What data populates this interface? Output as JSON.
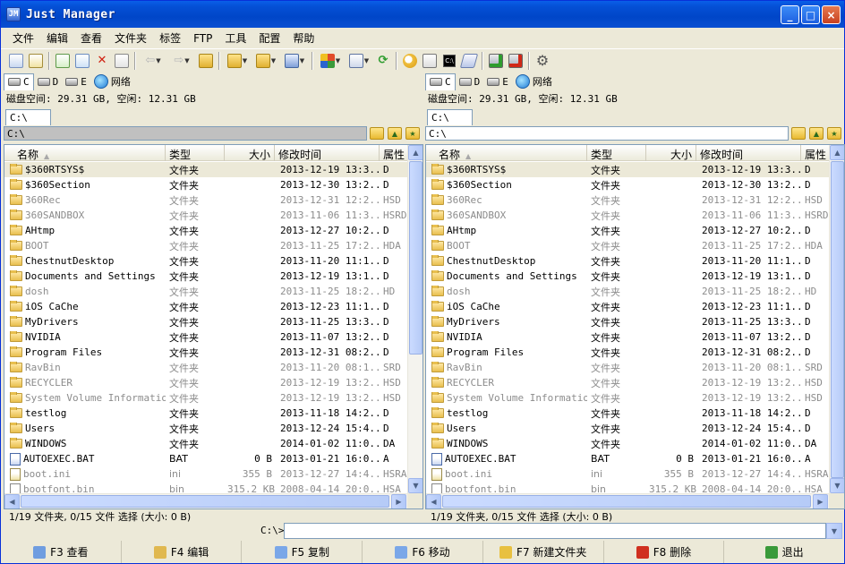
{
  "window": {
    "title": "Just Manager",
    "icon_text": "JM"
  },
  "title_buttons": {
    "minimize": "_",
    "maximize": "□",
    "close": "×"
  },
  "menu": [
    "文件",
    "编辑",
    "查看",
    "文件夹",
    "标签",
    "FTP",
    "工具",
    "配置",
    "帮助"
  ],
  "toolbar": {
    "icons": [
      "view-icon",
      "edit-icon",
      "new-file-icon",
      "copy-icon",
      "delete-icon",
      "properties-icon",
      "back-icon",
      "forward-icon",
      "up-folder-icon",
      "folder-dropdown-icon",
      "folder-sync-icon",
      "open-with-icon",
      "layout-icon",
      "sort-icon",
      "refresh-icon",
      "search-icon",
      "copy-path-icon",
      "console-icon",
      "tag-icon",
      "connect-icon",
      "disconnect-icon",
      "settings-icon"
    ],
    "console_label": "C:\\"
  },
  "panels": {
    "left": {
      "drives": [
        {
          "label": "C",
          "active": true
        },
        {
          "label": "D",
          "active": false
        },
        {
          "label": "E",
          "active": false
        }
      ],
      "network_label": "网络",
      "disk_info": "磁盘空间: 29.31 GB, 空闲: 12.31 GB",
      "tab": "C:\\",
      "path": "C:\\",
      "status": "1/19 文件夹, 0/15 文件 选择 (大小: 0 B)"
    },
    "right": {
      "drives": [
        {
          "label": "C",
          "active": true
        },
        {
          "label": "D",
          "active": false
        },
        {
          "label": "E",
          "active": false
        }
      ],
      "network_label": "网络",
      "disk_info": "磁盘空间: 29.31 GB, 空闲: 12.31 GB",
      "tab": "C:\\",
      "path": "C:\\",
      "status": "1/19 文件夹, 0/15 文件 选择 (大小: 0 B)"
    }
  },
  "columns": {
    "name": "名称",
    "type": "类型",
    "size": "大小",
    "mtime": "修改时间",
    "attr": "属性"
  },
  "files": [
    {
      "name": "$360RTSYS$",
      "type": "文件夹",
      "size": "",
      "mtime": "2013-12-19 13:3...",
      "attr": "D",
      "kind": "folder",
      "dim": false,
      "sel": true
    },
    {
      "name": "$360Section",
      "type": "文件夹",
      "size": "",
      "mtime": "2013-12-30 13:2...",
      "attr": "D",
      "kind": "folder",
      "dim": false,
      "sel": false
    },
    {
      "name": "360Rec",
      "type": "文件夹",
      "size": "",
      "mtime": "2013-12-31 12:2...",
      "attr": "HSD",
      "kind": "folder",
      "dim": true,
      "sel": false
    },
    {
      "name": "360SANDBOX",
      "type": "文件夹",
      "size": "",
      "mtime": "2013-11-06 11:3...",
      "attr": "HSRD",
      "kind": "folder",
      "dim": true,
      "sel": false
    },
    {
      "name": "AHtmp",
      "type": "文件夹",
      "size": "",
      "mtime": "2013-12-27 10:2...",
      "attr": "D",
      "kind": "folder",
      "dim": false,
      "sel": false
    },
    {
      "name": "BOOT",
      "type": "文件夹",
      "size": "",
      "mtime": "2013-11-25 17:2...",
      "attr": "HDA",
      "kind": "folder",
      "dim": true,
      "sel": false
    },
    {
      "name": "ChestnutDesktop",
      "type": "文件夹",
      "size": "",
      "mtime": "2013-11-20 11:1...",
      "attr": "D",
      "kind": "folder",
      "dim": false,
      "sel": false
    },
    {
      "name": "Documents and Settings",
      "type": "文件夹",
      "size": "",
      "mtime": "2013-12-19 13:1...",
      "attr": "D",
      "kind": "folder",
      "dim": false,
      "sel": false
    },
    {
      "name": "dosh",
      "type": "文件夹",
      "size": "",
      "mtime": "2013-11-25 18:2...",
      "attr": "HD",
      "kind": "folder",
      "dim": true,
      "sel": false
    },
    {
      "name": "iOS CaChe",
      "type": "文件夹",
      "size": "",
      "mtime": "2013-12-23 11:1...",
      "attr": "D",
      "kind": "folder",
      "dim": false,
      "sel": false
    },
    {
      "name": "MyDrivers",
      "type": "文件夹",
      "size": "",
      "mtime": "2013-11-25 13:3...",
      "attr": "D",
      "kind": "folder",
      "dim": false,
      "sel": false
    },
    {
      "name": "NVIDIA",
      "type": "文件夹",
      "size": "",
      "mtime": "2013-11-07 13:2...",
      "attr": "D",
      "kind": "folder",
      "dim": false,
      "sel": false
    },
    {
      "name": "Program Files",
      "type": "文件夹",
      "size": "",
      "mtime": "2013-12-31 08:2...",
      "attr": "D",
      "kind": "folder",
      "dim": false,
      "sel": false
    },
    {
      "name": "RavBin",
      "type": "文件夹",
      "size": "",
      "mtime": "2013-11-20 08:1...",
      "attr": "SRD",
      "kind": "folder",
      "dim": true,
      "sel": false
    },
    {
      "name": "RECYCLER",
      "type": "文件夹",
      "size": "",
      "mtime": "2013-12-19 13:2...",
      "attr": "HSD",
      "kind": "folder",
      "dim": true,
      "sel": false
    },
    {
      "name": "System Volume Information",
      "type": "文件夹",
      "size": "",
      "mtime": "2013-12-19 13:2...",
      "attr": "HSD",
      "kind": "folder",
      "dim": true,
      "sel": false
    },
    {
      "name": "testlog",
      "type": "文件夹",
      "size": "",
      "mtime": "2013-11-18 14:2...",
      "attr": "D",
      "kind": "folder",
      "dim": false,
      "sel": false
    },
    {
      "name": "Users",
      "type": "文件夹",
      "size": "",
      "mtime": "2013-12-24 15:4...",
      "attr": "D",
      "kind": "folder",
      "dim": false,
      "sel": false
    },
    {
      "name": "WINDOWS",
      "type": "文件夹",
      "size": "",
      "mtime": "2014-01-02 11:0...",
      "attr": "DA",
      "kind": "folder",
      "dim": false,
      "sel": false
    },
    {
      "name": "AUTOEXEC.BAT",
      "type": "BAT",
      "size": "0 B",
      "mtime": "2013-01-21 16:0...",
      "attr": "A",
      "kind": "bat",
      "dim": false,
      "sel": false
    },
    {
      "name": "boot.ini",
      "type": "ini",
      "size": "355 B",
      "mtime": "2013-12-27 14:4...",
      "attr": "HSRA",
      "kind": "ini",
      "dim": true,
      "sel": false
    },
    {
      "name": "bootfont.bin",
      "type": "bin",
      "size": "315.2 KB",
      "mtime": "2008-04-14 20:0...",
      "attr": "HSA",
      "kind": "file",
      "dim": true,
      "sel": false
    }
  ],
  "cmdline": {
    "label": "C:\\>",
    "value": ""
  },
  "fkeys": [
    {
      "label": "F3 查看",
      "icon": "view-icon",
      "color": "#6f9de0"
    },
    {
      "label": "F4 编辑",
      "icon": "edit-icon",
      "color": "#e0b850"
    },
    {
      "label": "F5 复制",
      "icon": "copy-icon",
      "color": "#7aa7e8"
    },
    {
      "label": "F6 移动",
      "icon": "move-icon",
      "color": "#7aa7e8"
    },
    {
      "label": "F7 新建文件夹",
      "icon": "new-folder-icon",
      "color": "#e8c040"
    },
    {
      "label": "F8 删除",
      "icon": "delete-icon",
      "color": "#d03020"
    },
    {
      "label": "退出",
      "icon": "exit-icon",
      "color": "#3a9a3a"
    }
  ],
  "colors": {
    "titlebar": "#0050d0",
    "selected_row": "#ece9d8",
    "dim_text": "#8c8c8c"
  }
}
